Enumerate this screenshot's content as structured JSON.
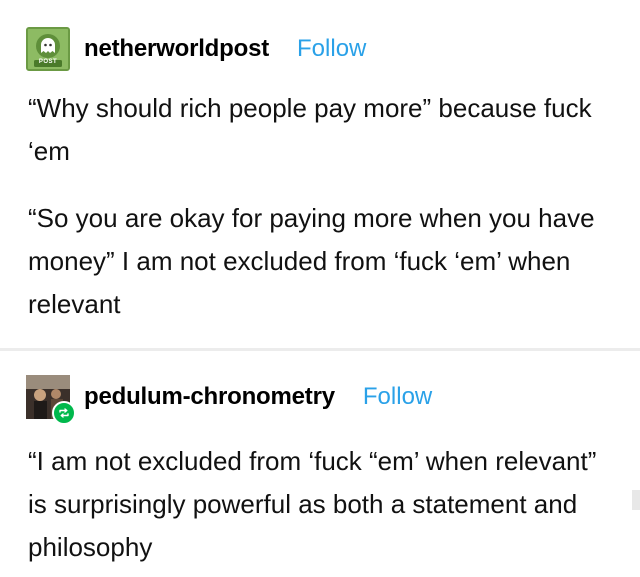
{
  "posts": [
    {
      "username": "netherworldpost",
      "follow_label": "Follow",
      "avatar_icon": "ghost-postmark-icon",
      "avatar_label": "POST",
      "paragraphs": [
        "“Why should rich people pay more” because fuck ‘em",
        "“So you are okay for paying more when you have money” I am not excluded from ‘fuck ‘em’ when relevant"
      ]
    },
    {
      "username": "pedulum-chronometry",
      "follow_label": "Follow",
      "avatar_icon": "photo-avatar",
      "badge_icon": "reblog-icon",
      "paragraphs": [
        "“I am not excluded from ‘fuck “em’ when relevant” is surprisingly powerful as both a statement and philosophy"
      ]
    }
  ],
  "colors": {
    "follow": "#2aa1e8",
    "divider": "#ececec",
    "reblog_badge": "#00b84c",
    "avatar_green": "#8dbb63"
  }
}
